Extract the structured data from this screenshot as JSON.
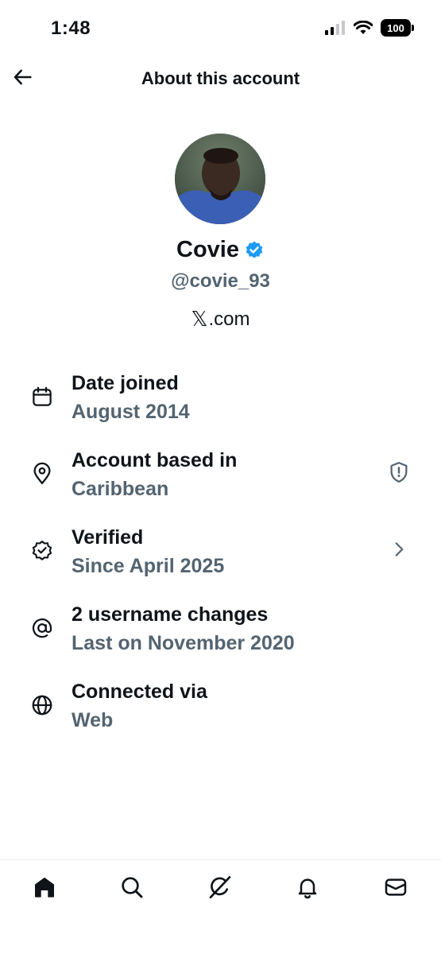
{
  "status_bar": {
    "time": "1:48",
    "battery": "100"
  },
  "header": {
    "title": "About this account",
    "back_icon": "arrow-left-icon"
  },
  "profile": {
    "name": "Covie",
    "handle": "@covie_93",
    "site_suffix": ".com",
    "site_logo": "𝕏",
    "verified_color": "#1d9bf0"
  },
  "info": [
    {
      "icon": "calendar-icon",
      "title": "Date joined",
      "value": "August 2014"
    },
    {
      "icon": "location-pin-icon",
      "title": "Account based in",
      "value": "Caribbean",
      "trailing": "shield-alert-icon"
    },
    {
      "icon": "verified-badge-icon",
      "title": "Verified",
      "value": "Since April 2025",
      "trailing": "chevron-right-icon"
    },
    {
      "icon": "at-sign-icon",
      "title": "2 username changes",
      "value": "Last on November 2020"
    },
    {
      "icon": "globe-icon",
      "title": "Connected via",
      "value": "Web"
    }
  ],
  "tabs": [
    "home-icon",
    "search-icon",
    "grok-icon",
    "bell-icon",
    "mail-icon"
  ],
  "colors": {
    "text_primary": "#0f1419",
    "text_secondary": "#536471",
    "accent": "#1d9bf0"
  }
}
